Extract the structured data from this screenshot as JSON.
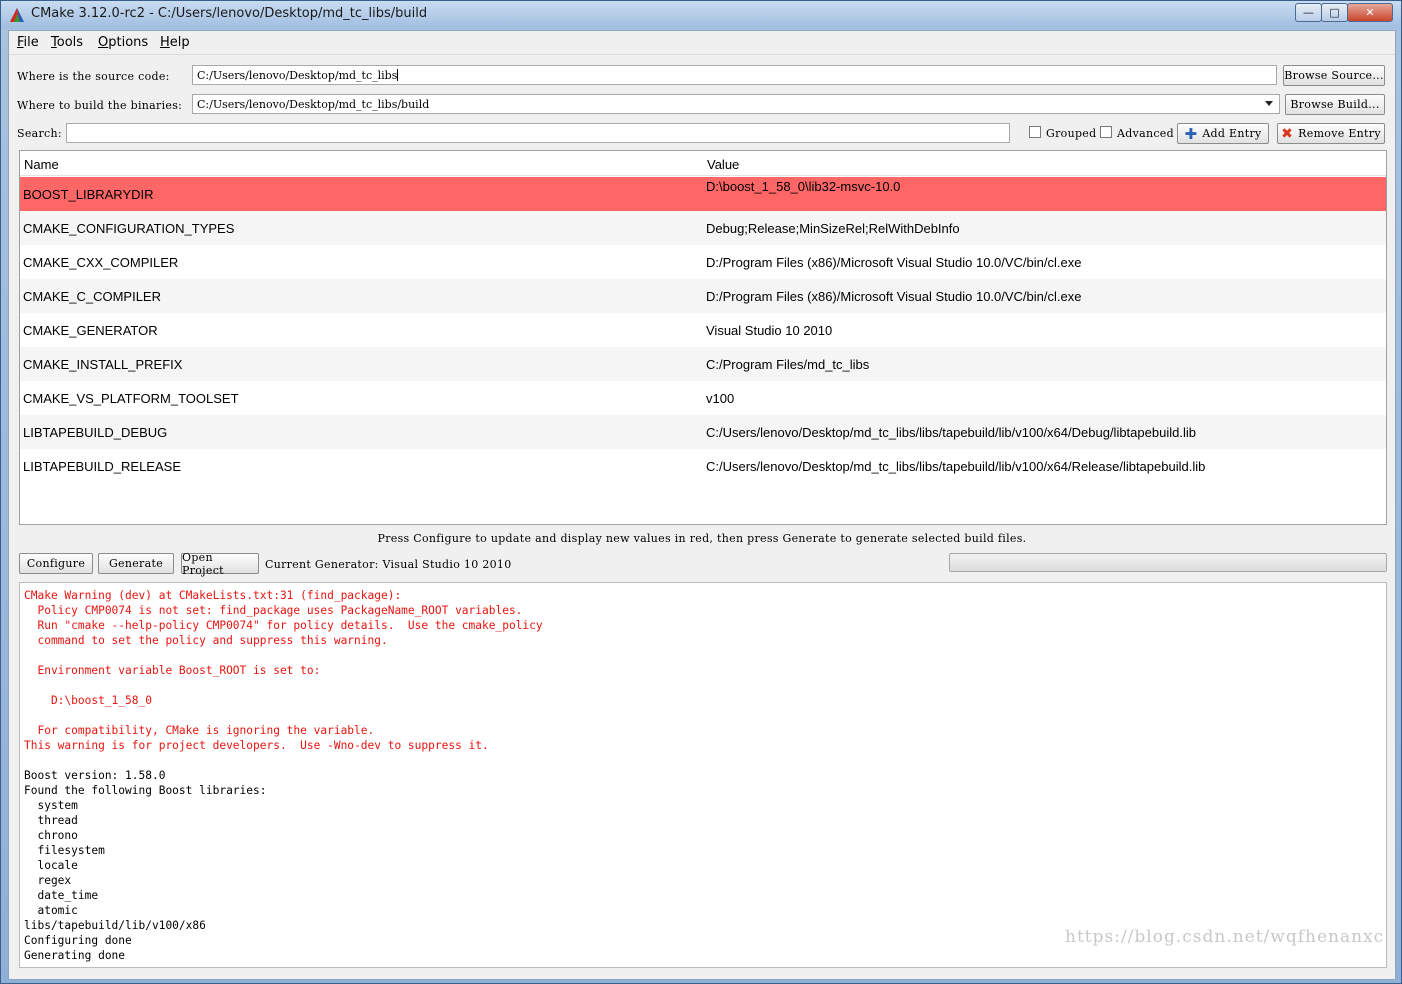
{
  "window": {
    "title": "CMake 3.12.0-rc2 - C:/Users/lenovo/Desktop/md_tc_libs/build",
    "minimize_glyph": "—",
    "maximize_glyph": "□",
    "close_glyph": "✕"
  },
  "menu": {
    "file": {
      "accel": "F",
      "rest": "ile"
    },
    "tools": {
      "accel": "T",
      "rest": "ools"
    },
    "options": {
      "accel": "O",
      "rest": "ptions"
    },
    "help": {
      "accel": "H",
      "rest": "elp"
    }
  },
  "paths": {
    "source_label": "Where is the source code:",
    "source_value": "C:/Users/lenovo/Desktop/md_tc_libs",
    "browse_source": "Browse Source...",
    "build_label": "Where to build the binaries:",
    "build_value": "C:/Users/lenovo/Desktop/md_tc_libs/build",
    "browse_build": "Browse Build..."
  },
  "search": {
    "label": "Search:",
    "value": "",
    "grouped_label": "Grouped",
    "grouped_checked": false,
    "advanced_label": "Advanced",
    "advanced_checked": false,
    "add_entry": "Add Entry",
    "remove_entry": "Remove Entry"
  },
  "table": {
    "columns": [
      "Name",
      "Value"
    ],
    "rows": [
      {
        "name": "BOOST_LIBRARYDIR",
        "value": "D:\\boost_1_58_0\\lib32-msvc-10.0",
        "is_new": true
      },
      {
        "name": "CMAKE_CONFIGURATION_TYPES",
        "value": "Debug;Release;MinSizeRel;RelWithDebInfo",
        "is_new": false
      },
      {
        "name": "CMAKE_CXX_COMPILER",
        "value": "D:/Program Files (x86)/Microsoft Visual Studio 10.0/VC/bin/cl.exe",
        "is_new": false
      },
      {
        "name": "CMAKE_C_COMPILER",
        "value": "D:/Program Files (x86)/Microsoft Visual Studio 10.0/VC/bin/cl.exe",
        "is_new": false
      },
      {
        "name": "CMAKE_GENERATOR",
        "value": "Visual Studio 10 2010",
        "is_new": false
      },
      {
        "name": "CMAKE_INSTALL_PREFIX",
        "value": "C:/Program Files/md_tc_libs",
        "is_new": false
      },
      {
        "name": "CMAKE_VS_PLATFORM_TOOLSET",
        "value": "v100",
        "is_new": false
      },
      {
        "name": "LIBTAPEBUILD_DEBUG",
        "value": "C:/Users/lenovo/Desktop/md_tc_libs/libs/tapebuild/lib/v100/x64/Debug/libtapebuild.lib",
        "is_new": false
      },
      {
        "name": "LIBTAPEBUILD_RELEASE",
        "value": "C:/Users/lenovo/Desktop/md_tc_libs/libs/tapebuild/lib/v100/x64/Release/libtapebuild.lib",
        "is_new": false
      }
    ]
  },
  "hint": "Press Configure to update and display new values in red, then press Generate to generate selected build files.",
  "actions": {
    "configure": "Configure",
    "generate": "Generate",
    "open_project": "Open Project",
    "current_generator": "Current Generator: Visual Studio 10 2010",
    "progress": 0
  },
  "output": [
    {
      "text": "CMake Warning (dev) at CMakeLists.txt:31 (find_package):",
      "kind": "warn"
    },
    {
      "text": "  Policy CMP0074 is not set: find_package uses PackageName_ROOT variables.",
      "kind": "warn"
    },
    {
      "text": "  Run \"cmake --help-policy CMP0074\" for policy details.  Use the cmake_policy",
      "kind": "warn"
    },
    {
      "text": "  command to set the policy and suppress this warning.",
      "kind": "warn"
    },
    {
      "text": "",
      "kind": "warn"
    },
    {
      "text": "  Environment variable Boost_ROOT is set to:",
      "kind": "warn"
    },
    {
      "text": "",
      "kind": "warn"
    },
    {
      "text": "    D:\\boost_1_58_0",
      "kind": "warn"
    },
    {
      "text": "",
      "kind": "warn"
    },
    {
      "text": "  For compatibility, CMake is ignoring the variable.",
      "kind": "warn"
    },
    {
      "text": "This warning is for project developers.  Use -Wno-dev to suppress it.",
      "kind": "warn"
    },
    {
      "text": "",
      "kind": "info"
    },
    {
      "text": "Boost version: 1.58.0",
      "kind": "info"
    },
    {
      "text": "Found the following Boost libraries:",
      "kind": "info"
    },
    {
      "text": "  system",
      "kind": "info"
    },
    {
      "text": "  thread",
      "kind": "info"
    },
    {
      "text": "  chrono",
      "kind": "info"
    },
    {
      "text": "  filesystem",
      "kind": "info"
    },
    {
      "text": "  locale",
      "kind": "info"
    },
    {
      "text": "  regex",
      "kind": "info"
    },
    {
      "text": "  date_time",
      "kind": "info"
    },
    {
      "text": "  atomic",
      "kind": "info"
    },
    {
      "text": "libs/tapebuild/lib/v100/x86",
      "kind": "info"
    },
    {
      "text": "Configuring done",
      "kind": "info"
    },
    {
      "text": "Generating done",
      "kind": "info"
    }
  ],
  "watermark": "https://blog.csdn.net/wqfhenanxc",
  "colors": {
    "new_entry_row": "#ff6666",
    "warning_text": "#e8140f",
    "add_icon": "#2b5fb3",
    "remove_icon": "#d9361e"
  },
  "icons": {
    "app": "cmake-triangle-icon",
    "add": "plus-icon",
    "remove": "x-icon"
  }
}
